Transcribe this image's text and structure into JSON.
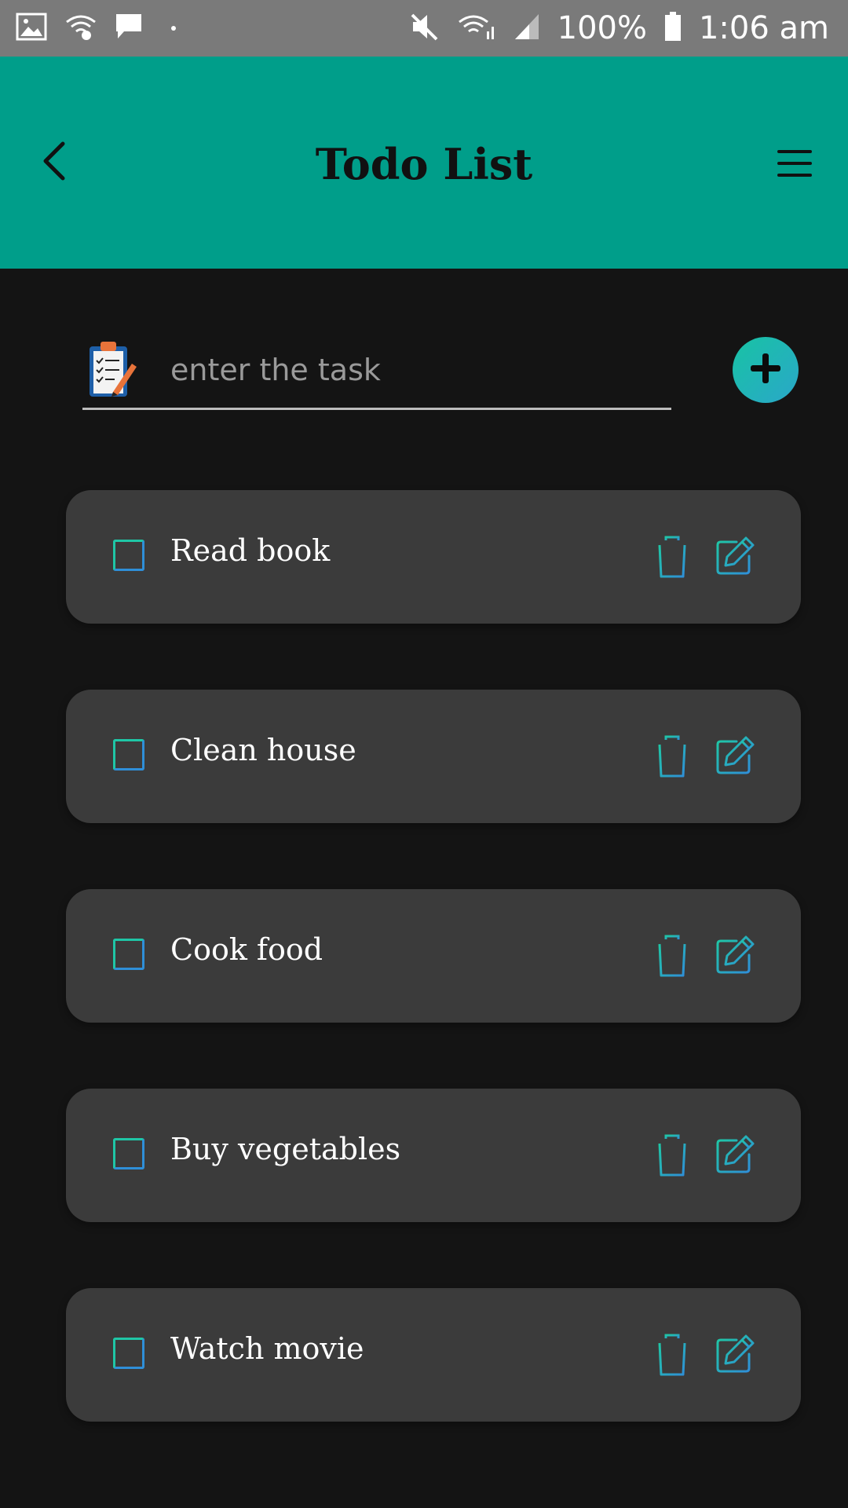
{
  "status_bar": {
    "battery": "100%",
    "time": "1:06 am",
    "left_icons": [
      "image-icon",
      "wifi-icon",
      "message-icon"
    ],
    "right_icons": [
      "mute-icon",
      "wifi-signal-icon",
      "cell-signal-icon",
      "battery-icon"
    ]
  },
  "app_bar": {
    "title": "Todo List",
    "color": "#009e8a",
    "back_icon": "chevron-left-icon",
    "menu_icon": "hamburger-menu-icon"
  },
  "input": {
    "placeholder": "enter the task",
    "value": "",
    "icon": "clipboard-icon",
    "add_icon": "plus-icon"
  },
  "tasks": [
    {
      "label": "Read book",
      "checked": false
    },
    {
      "label": "Clean house",
      "checked": false
    },
    {
      "label": "Cook food",
      "checked": false
    },
    {
      "label": "Buy vegetables",
      "checked": false
    },
    {
      "label": "Watch movie",
      "checked": false
    }
  ],
  "colors": {
    "background": "#141414",
    "card": "#3b3b3b",
    "accent_start": "#18c3a4",
    "accent_end": "#2aa7c9"
  }
}
